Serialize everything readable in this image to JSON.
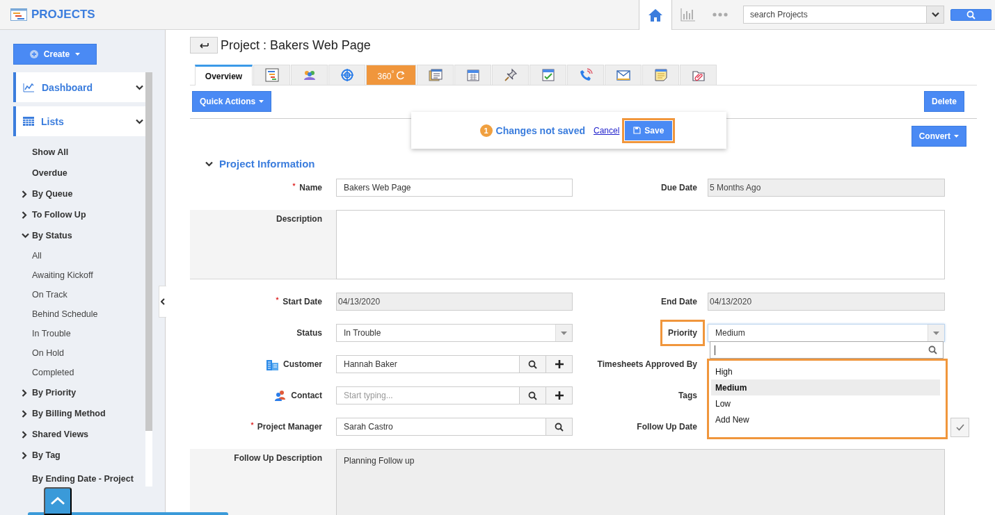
{
  "app": {
    "title": "PROJECTS"
  },
  "top_nav": [
    {
      "selected": true
    },
    {
      "selected": false
    },
    {
      "selected": false
    }
  ],
  "search": {
    "placeholder": "search Projects"
  },
  "sidebar": {
    "create_label": "Create",
    "sections": [
      {
        "label": "Dashboard"
      },
      {
        "label": "Lists"
      }
    ],
    "items": [
      {
        "kind": "link",
        "label": "Show All"
      },
      {
        "kind": "link",
        "label": "Overdue"
      },
      {
        "kind": "group",
        "label": "By Queue",
        "expanded": false
      },
      {
        "kind": "group",
        "label": "To Follow Up",
        "expanded": false
      },
      {
        "kind": "group",
        "label": "By Status",
        "expanded": true,
        "children": [
          {
            "label": "All"
          },
          {
            "label": "Awaiting Kickoff"
          },
          {
            "label": "On Track"
          },
          {
            "label": "Behind Schedule"
          },
          {
            "label": "In Trouble"
          },
          {
            "label": "On Hold"
          },
          {
            "label": "Completed"
          }
        ]
      },
      {
        "kind": "group",
        "label": "By Priority",
        "expanded": false
      },
      {
        "kind": "group",
        "label": "By Billing Method",
        "expanded": false
      },
      {
        "kind": "group",
        "label": "Shared Views",
        "expanded": false
      },
      {
        "kind": "group",
        "label": "By Tag",
        "expanded": false
      },
      {
        "kind": "link",
        "label": "By Ending Date - Project"
      }
    ]
  },
  "page": {
    "title": "Project : Bakers Web Page"
  },
  "tabs": [
    {
      "kind": "text",
      "label": "Overview",
      "selected": true
    },
    {
      "kind": "icon",
      "selected": false
    },
    {
      "kind": "icon",
      "selected": false
    },
    {
      "kind": "icon",
      "selected": false
    },
    {
      "kind": "badge",
      "label": "360$^{°}$",
      "selected": false
    },
    {
      "kind": "icon",
      "selected": false
    },
    {
      "kind": "icon",
      "selected": false
    },
    {
      "kind": "icon",
      "selected": false
    },
    {
      "kind": "icon",
      "selected": false
    },
    {
      "kind": "icon",
      "selected": false
    },
    {
      "kind": "icon",
      "selected": false
    },
    {
      "kind": "icon",
      "selected": false
    },
    {
      "kind": "icon",
      "selected": false
    }
  ],
  "actions": {
    "quick": "Quick Actions",
    "delete": "Delete",
    "convert": "Convert"
  },
  "unsaved": {
    "count": "1",
    "message": "Changes not saved",
    "cancel": "Cancel",
    "save": "Save",
    "highlighted": true
  },
  "section": {
    "title": "Project Information",
    "expanded": true
  },
  "form": {
    "rows": [
      {
        "left": {
          "label": "Name",
          "required": true,
          "kind": "text",
          "value": "Bakers Web Page"
        },
        "right": {
          "label": "Due Date",
          "kind": "text",
          "disabled": true,
          "value": "5 Months Ago"
        }
      },
      {
        "wide": {
          "label": "Description",
          "kind": "textarea"
        }
      },
      {
        "left": {
          "label": "Start Date",
          "required": true,
          "kind": "text",
          "disabled": true,
          "value": "04/13/2020"
        },
        "right": {
          "label": "End Date",
          "kind": "text",
          "disabled": true,
          "value": "04/13/2020"
        }
      },
      {
        "left": {
          "label": "Status",
          "kind": "select",
          "value": "In Trouble"
        },
        "right": {
          "label": "Priority",
          "kind": "select",
          "value": "Medium",
          "highlighted": true,
          "open": true,
          "options_highlighted": true,
          "options": [
            {
              "label": "High",
              "selected": false
            },
            {
              "label": "Medium",
              "selected": true
            },
            {
              "label": "Low",
              "selected": false
            },
            {
              "label": "Add New",
              "selected": false
            }
          ]
        }
      },
      {
        "left": {
          "label": "Customer",
          "kind": "lookup",
          "addable": true,
          "value": "Hannah Baker"
        },
        "right": {
          "label": "Timesheets Approved By"
        }
      },
      {
        "left": {
          "label": "Contact",
          "kind": "lookup",
          "addable": true,
          "placeholder": "Start typing..."
        },
        "right": {
          "label": "Tags"
        }
      },
      {
        "left": {
          "label": "Project Manager",
          "required": true,
          "kind": "lookup",
          "addable": false,
          "value": "Sarah Castro"
        },
        "right": {
          "label": "Follow Up Date",
          "confirm": true
        }
      },
      {
        "wide": {
          "label": "Follow Up Description",
          "kind": "textarea",
          "disabled": true,
          "value": "Planning Follow up"
        }
      }
    ]
  }
}
